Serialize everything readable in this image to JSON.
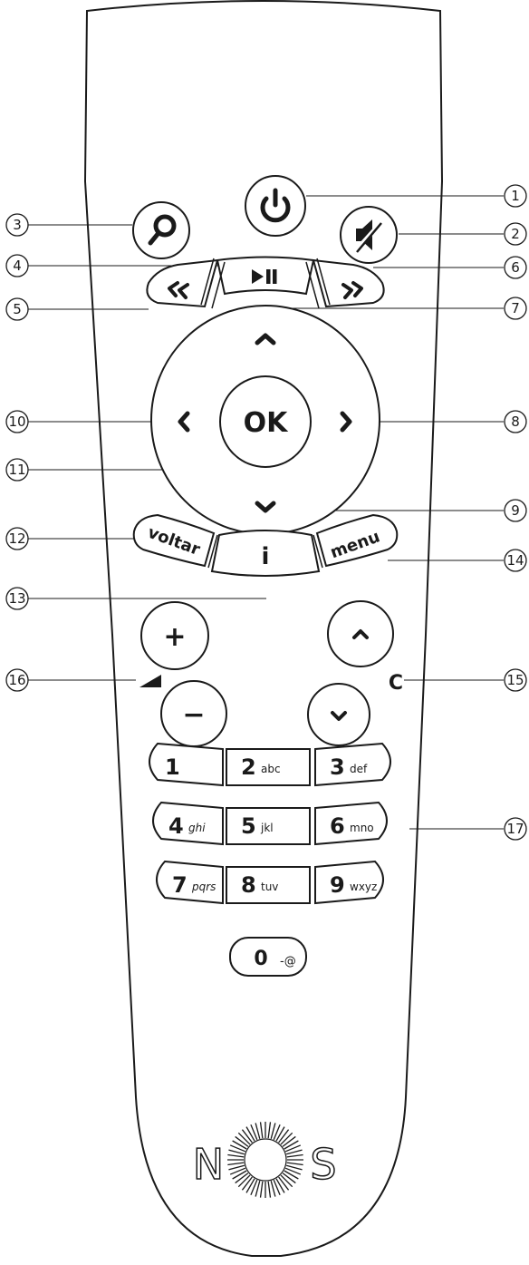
{
  "remote": {
    "buttons": {
      "ok": "OK",
      "voltar": "voltar",
      "info": "i",
      "menu": "menu",
      "vol_plus": "+",
      "vol_minus": "−",
      "channel_label": "C",
      "zero": "0",
      "zero_sub": "-@"
    },
    "keypad": [
      {
        "digit": "1",
        "letters": ""
      },
      {
        "digit": "2",
        "letters": "abc"
      },
      {
        "digit": "3",
        "letters": "def"
      },
      {
        "digit": "4",
        "letters": "ghi"
      },
      {
        "digit": "5",
        "letters": "jkl"
      },
      {
        "digit": "6",
        "letters": "mno"
      },
      {
        "digit": "7",
        "letters": "pqrs"
      },
      {
        "digit": "8",
        "letters": "tuv"
      },
      {
        "digit": "9",
        "letters": "wxyz"
      }
    ],
    "brand": {
      "left": "N",
      "right": "S"
    }
  },
  "callouts": [
    "1",
    "2",
    "3",
    "4",
    "5",
    "6",
    "7",
    "8",
    "9",
    "10",
    "11",
    "12",
    "13",
    "14",
    "15",
    "16",
    "17"
  ],
  "icons": [
    "power-icon",
    "mute-icon",
    "search-icon",
    "play-pause-icon",
    "rewind-icon",
    "fast-forward-icon",
    "arrow-up-icon",
    "arrow-down-icon",
    "arrow-left-icon",
    "arrow-right-icon",
    "channel-up-icon",
    "channel-down-icon",
    "volume-icon",
    "nos-sun-logo"
  ]
}
